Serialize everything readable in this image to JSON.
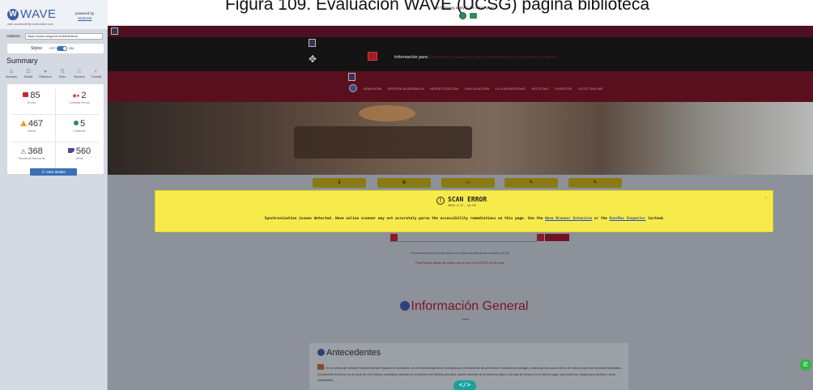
{
  "caption": "Figura 109. Evaluación WAVE (UCSG) página biblioteca",
  "wave": {
    "brand": "WAVE",
    "tagline": "web accessibility evaluation tool",
    "powered_by": "powered by",
    "powered_link": "WebAIM",
    "address_label": "Address:",
    "address_value": "https://www.ucsg.edu.ec/biblioteca/",
    "styles_label": "Styles:",
    "styles_off": "OFF",
    "styles_on": "ON",
    "summary_title": "Summary",
    "tabs": [
      {
        "label": "Summary",
        "icon": "home-icon"
      },
      {
        "label": "Details",
        "icon": "list-icon"
      },
      {
        "label": "Reference",
        "icon": "info-icon"
      },
      {
        "label": "Order",
        "icon": "order-icon"
      },
      {
        "label": "Structure",
        "icon": "structure-icon"
      },
      {
        "label": "Contrast",
        "icon": "contrast-icon"
      }
    ],
    "stats": {
      "errors": {
        "value": "85",
        "label": "Errors"
      },
      "contrast": {
        "value": "2",
        "label": "Contrast Errors"
      },
      "alerts": {
        "value": "467",
        "label": "Alerts"
      },
      "features": {
        "value": "5",
        "label": "Features"
      },
      "structure": {
        "value": "368",
        "label": "Structural Elements"
      },
      "aria": {
        "value": "560",
        "label": "ARIA"
      }
    },
    "view_details": "View details"
  },
  "toolbar": {
    "note": "The following apply to the entire page:"
  },
  "site": {
    "info_label": "Información para:",
    "info_links": "Estudiantes | Graduados | Alumnos | Personal UCSG | Comunidad | Visitantes",
    "menu": [
      "ADMISIÓN",
      "OFERTA ACADÉMICA",
      "INVESTIGACIÓN",
      "VINCULACIÓN",
      "LA UNIVERSIDAD",
      "NOTICIAS",
      "EVENTOS",
      "UCSG ONLINE"
    ],
    "small1": "Herramienta que permite buscar en todas las bibliotecas virtuales UCSG",
    "small2": "Para buscar desde las redes que no son de la UCSG de clic aquí",
    "section_title": "Información General",
    "antecedentes": "Antecedentes",
    "paragraph": "En la misma de creación estuvo siempre ligada a la formación de la biblioteca general, ésta gracias a donaciones de personas e instituciones amigas, hasta apenas pocos libros de manera que era necesario ampliarla. Inicialmente funcionó en un local de 100 metros cuadrados ubicado en la primera del edificio principal, donde además de la atención había una sala de lectura en el mismo lugar, que podía ser usada para lectura y otras actividades."
  },
  "scan_error": {
    "title": "SCAN ERROR",
    "date": "2025-4-17, 16:59",
    "message_pre": "Synchronization issues detected. Wave online scanner may not accurately parse the accessibility remediations on this page. Use the ",
    "link1": "Wave Browser Extension",
    "message_mid": " or the ",
    "link2": "OverDev Inspector",
    "message_post": " instead.",
    "close": "×"
  },
  "code_button": "</>",
  "colors": {
    "wave_blue": "#3b6fb6",
    "error_red": "#c62828",
    "alert_orange": "#e4a11b",
    "feature_green": "#2e8b57",
    "aria_purple": "#5b3b9b",
    "scan_yellow": "#f6eb4a",
    "site_maroon": "#5a0f1e"
  }
}
